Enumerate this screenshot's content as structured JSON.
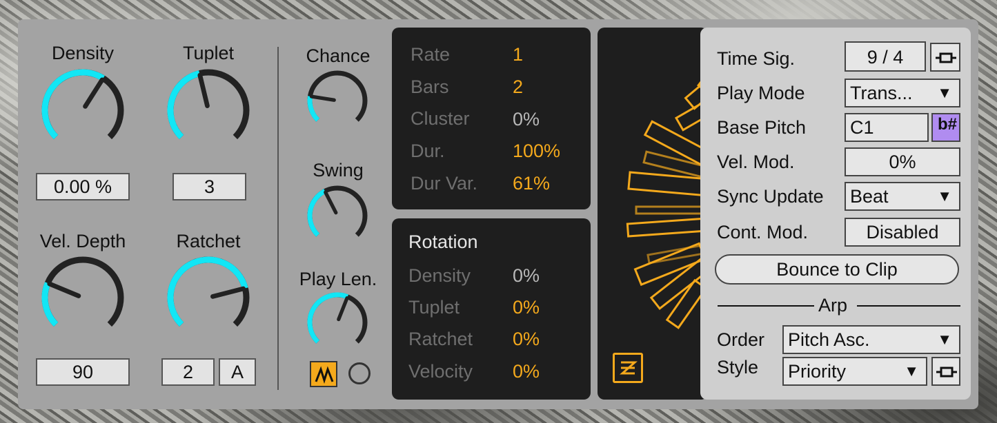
{
  "colors": {
    "accent_cyan": "#12e6f5",
    "accent_orange": "#f4a91c",
    "accent_purple": "#b08cf0",
    "panel": "#a3a3a3",
    "dark_panel": "#1e1e1e",
    "knob_track": "#222222"
  },
  "knobs": {
    "density": {
      "label": "Density",
      "value": "0.00 %",
      "level": 0.62
    },
    "tuplet": {
      "label": "Tuplet",
      "value": "3",
      "level": 0.45
    },
    "vel_depth": {
      "label": "Vel. Depth",
      "value": "90",
      "level": 0.25
    },
    "ratchet": {
      "label": "Ratchet",
      "value": "2",
      "mode": "A",
      "level": 0.78
    },
    "chance": {
      "label": "Chance",
      "level": 0.2
    },
    "swing": {
      "label": "Swing",
      "level": 0.4
    },
    "play_len": {
      "label": "Play Len.",
      "level": 0.58
    }
  },
  "icons": {
    "play_len_mode": "m-wave-icon",
    "toggle": "circle-toggle-icon",
    "rhythm": "rhythm-icon",
    "sharp_flat": "sharp-flat-icon",
    "link": "link-icon"
  },
  "params": [
    {
      "label": "Rate",
      "value": "1",
      "highlight": true
    },
    {
      "label": "Bars",
      "value": "2",
      "highlight": true
    },
    {
      "label": "Cluster",
      "value": "0%",
      "highlight": false
    },
    {
      "label": "Dur.",
      "value": "100%",
      "highlight": true
    },
    {
      "label": "Dur Var.",
      "value": "61%",
      "highlight": true
    }
  ],
  "rotation": {
    "title": "Rotation",
    "rows": [
      {
        "label": "Density",
        "value": "0%",
        "highlight": false
      },
      {
        "label": "Tuplet",
        "value": "0%",
        "highlight": true
      },
      {
        "label": "Ratchet",
        "value": "0%",
        "highlight": true
      },
      {
        "label": "Velocity",
        "value": "0%",
        "highlight": true
      }
    ]
  },
  "settings": {
    "time_sig_label": "Time Sig.",
    "time_sig_value": "9 / 4",
    "play_mode_label": "Play Mode",
    "play_mode_value": "Trans...",
    "base_pitch_label": "Base Pitch",
    "base_pitch_value": "C1",
    "sharp_flat_glyph": "b#",
    "vel_mod_label": "Vel. Mod.",
    "vel_mod_value": "0%",
    "sync_update_label": "Sync Update",
    "sync_update_value": "Beat",
    "cont_mod_label": "Cont. Mod.",
    "cont_mod_value": "Disabled",
    "bounce_label": "Bounce to Clip",
    "arp_label": "Arp",
    "order_label": "Order",
    "order_value": "Pitch Asc.",
    "style_label": "Style",
    "style_value": "Priority"
  },
  "dropdown_arrow": "▼"
}
